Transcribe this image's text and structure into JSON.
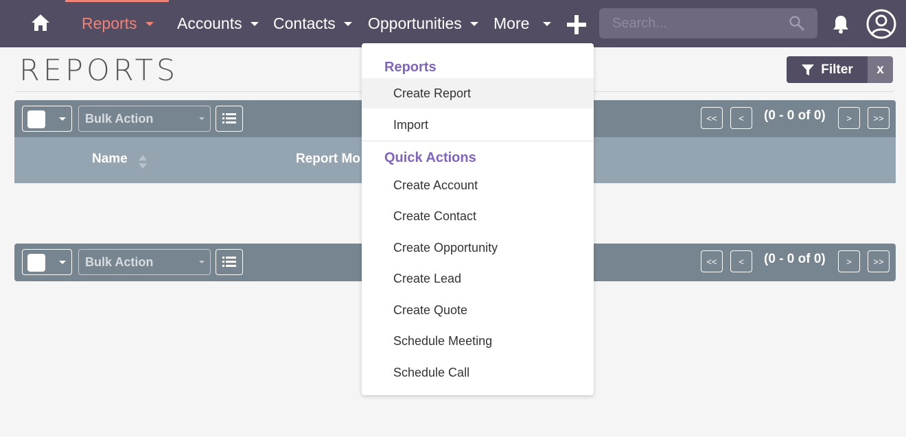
{
  "nav": {
    "items": [
      {
        "label": "Reports",
        "active": true
      },
      {
        "label": "Accounts"
      },
      {
        "label": "Contacts"
      },
      {
        "label": "Opportunities"
      },
      {
        "label": "More"
      }
    ],
    "search_placeholder": "Search...",
    "colors": {
      "bar": "#534d64",
      "active": "#f08377",
      "accent": "#8064be"
    }
  },
  "page": {
    "title": "REPORTS",
    "filter_label": "Filter",
    "filter_clear": "x"
  },
  "list": {
    "bulk_action": "Bulk Action",
    "pagination": {
      "first": "<<",
      "prev": "<",
      "next": ">",
      "last": ">>",
      "count": "(0 - 0 of 0)"
    },
    "columns": [
      "Name",
      "Report Mo"
    ]
  },
  "dropdown": {
    "section1": {
      "heading": "Reports",
      "items": [
        "Create Report",
        "Import"
      ]
    },
    "section2": {
      "heading": "Quick Actions",
      "items": [
        "Create Account",
        "Create Contact",
        "Create Opportunity",
        "Create Lead",
        "Create Quote",
        "Schedule Meeting",
        "Schedule Call"
      ]
    }
  }
}
